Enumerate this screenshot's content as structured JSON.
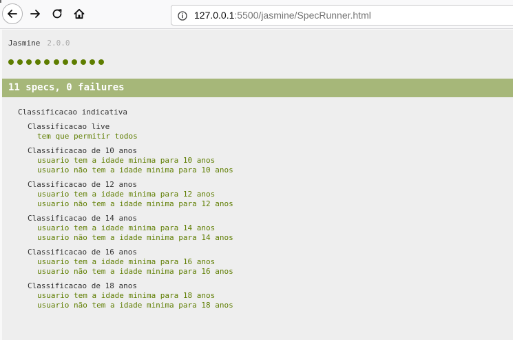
{
  "browser": {
    "url_host": "127.0.0.1",
    "url_path": ":5500/jasmine/SpecRunner.html",
    "icons": [
      "back-arrow-icon",
      "forward-arrow-icon",
      "reload-icon",
      "home-icon",
      "info-icon"
    ]
  },
  "reporter": {
    "title": "Jasmine",
    "version": "2.0.0",
    "passed_spec_count": 11,
    "summary": "11 specs, 0 failures",
    "colors": {
      "passed": "#5e7d00",
      "summary_bar": "#a6b779",
      "summary_text": "#ffffff",
      "suite_text": "#333333"
    }
  },
  "suite": {
    "title": "Classificacao indicativa",
    "children": [
      {
        "title": "Classificacao live",
        "specs": [
          "tem que permitir todos"
        ]
      },
      {
        "title": "Classificacao de 10 anos",
        "specs": [
          "usuario tem a idade minima para 10 anos",
          "usuario não tem a idade minima para 10 anos"
        ]
      },
      {
        "title": "Classificacao de 12 anos",
        "specs": [
          "usuario tem a idade minima para 12 anos",
          "usuario não tem a idade minima para 12 anos"
        ]
      },
      {
        "title": "Classificacao de 14 anos",
        "specs": [
          "usuario tem a idade minima para 14 anos",
          "usuario não tem a idade minima para 14 anos"
        ]
      },
      {
        "title": "Classificacao de 16 anos",
        "specs": [
          "usuario tem a idade minima para 16 anos",
          "usuario não tem a idade minima para 16 anos"
        ]
      },
      {
        "title": "Classificacao de 18 anos",
        "specs": [
          "usuario tem a idade minima para 18 anos",
          "usuario não tem a idade minima para 18 anos"
        ]
      }
    ]
  }
}
